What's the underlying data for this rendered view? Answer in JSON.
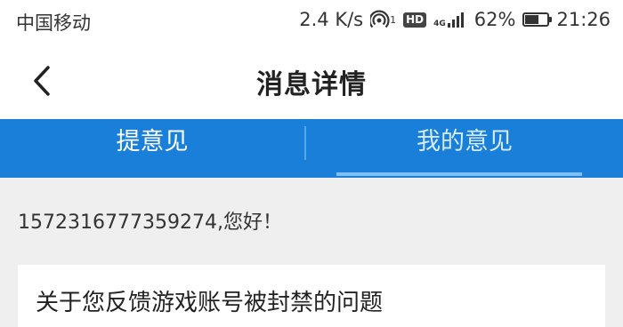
{
  "status_bar": {
    "carrier": "中国移动",
    "speed": "2.4 K/s",
    "hotspot_count": "1",
    "hd_label": "HD",
    "network_type": "4G",
    "battery_percent": "62%",
    "battery_level": 0.62,
    "time": "21:26"
  },
  "header": {
    "title": "消息详情",
    "back_icon": "chevron-left-icon"
  },
  "tabs": [
    {
      "label": "提意见",
      "selected": false
    },
    {
      "label": "我的意见",
      "selected": true
    }
  ],
  "colors": {
    "tab_bar": "#1a7fd8",
    "indicator": "#7ec0f7",
    "page_background": "#efefef"
  },
  "content": {
    "greeting": "1572316777359274,您好！",
    "message_title": "关于您反馈游戏账号被封禁的问题"
  }
}
